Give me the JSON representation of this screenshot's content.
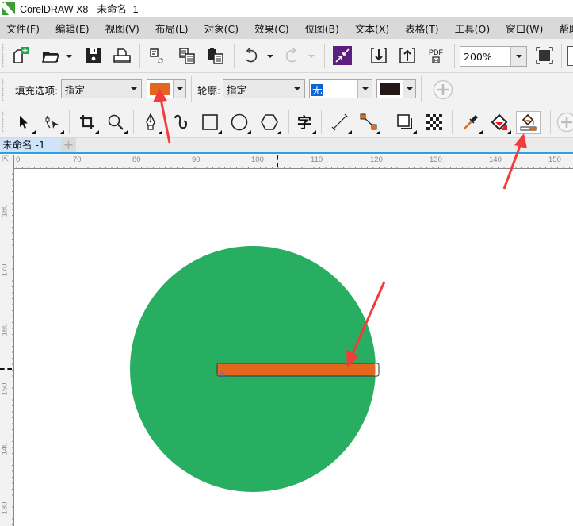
{
  "window": {
    "title": "CorelDRAW X8 - 未命名 -1",
    "app_icon": "coreldraw-logo-icon"
  },
  "menu": [
    {
      "label": "文件(F)"
    },
    {
      "label": "编辑(E)"
    },
    {
      "label": "视图(V)"
    },
    {
      "label": "布局(L)"
    },
    {
      "label": "对象(C)"
    },
    {
      "label": "效果(C)"
    },
    {
      "label": "位图(B)"
    },
    {
      "label": "文本(X)"
    },
    {
      "label": "表格(T)"
    },
    {
      "label": "工具(O)"
    },
    {
      "label": "窗口(W)"
    },
    {
      "label": "帮助(H)"
    }
  ],
  "standard_toolbar": {
    "items": [
      "new-document-icon",
      "open-icon",
      "save-icon",
      "print-icon",
      "cut-icon",
      "copy-icon",
      "paste-icon",
      "undo-icon",
      "redo-icon",
      "corel-connect-icon",
      "import-icon",
      "export-icon",
      "publish-pdf-icon",
      "full-screen-preview-icon"
    ],
    "pdf_label": "PDF",
    "zoom_level": "200%"
  },
  "property_bar": {
    "fill_label": "填充选项:",
    "fill_option": "指定",
    "fill_color": "#e3671e",
    "outline_label": "轮廓:",
    "outline_option": "指定",
    "outline_width": "无",
    "outline_color": "#231815"
  },
  "toolbox": {
    "tools": [
      {
        "name": "pick-tool",
        "active": false
      },
      {
        "name": "shape-tool",
        "active": false
      },
      {
        "name": "crop-tool",
        "active": false
      },
      {
        "name": "zoom-tool",
        "active": false
      },
      {
        "name": "pen-tool",
        "active": false
      },
      {
        "name": "artistic-media-tool",
        "active": false
      },
      {
        "name": "rectangle-tool",
        "active": false
      },
      {
        "name": "ellipse-tool",
        "active": false
      },
      {
        "name": "polygon-tool",
        "active": false
      },
      {
        "name": "text-tool",
        "active": false
      },
      {
        "name": "parallel-dimension-tool",
        "active": false
      },
      {
        "name": "connector-tool",
        "active": false
      },
      {
        "name": "drop-shadow-tool",
        "active": false
      },
      {
        "name": "transparency-tool",
        "active": false
      },
      {
        "name": "eyedropper-tool",
        "active": false
      },
      {
        "name": "interactive-fill-tool",
        "active": false
      },
      {
        "name": "smart-fill-tool",
        "active": true
      }
    ],
    "text_tool_glyph": "字"
  },
  "document_tabs": [
    {
      "label": "未命名 -1",
      "active": true
    }
  ],
  "add_tab_label": "+",
  "rulers": {
    "horizontal": [
      "0",
      "70",
      "80",
      "90",
      "100",
      "110",
      "120",
      "130",
      "140",
      "150"
    ],
    "vertical": [
      "180",
      "170",
      "160",
      "150",
      "140",
      "130"
    ]
  },
  "canvas": {
    "circle_color": "#27ae60",
    "bar_color": "#e3671e",
    "annotation_color": "#f23b3b"
  }
}
